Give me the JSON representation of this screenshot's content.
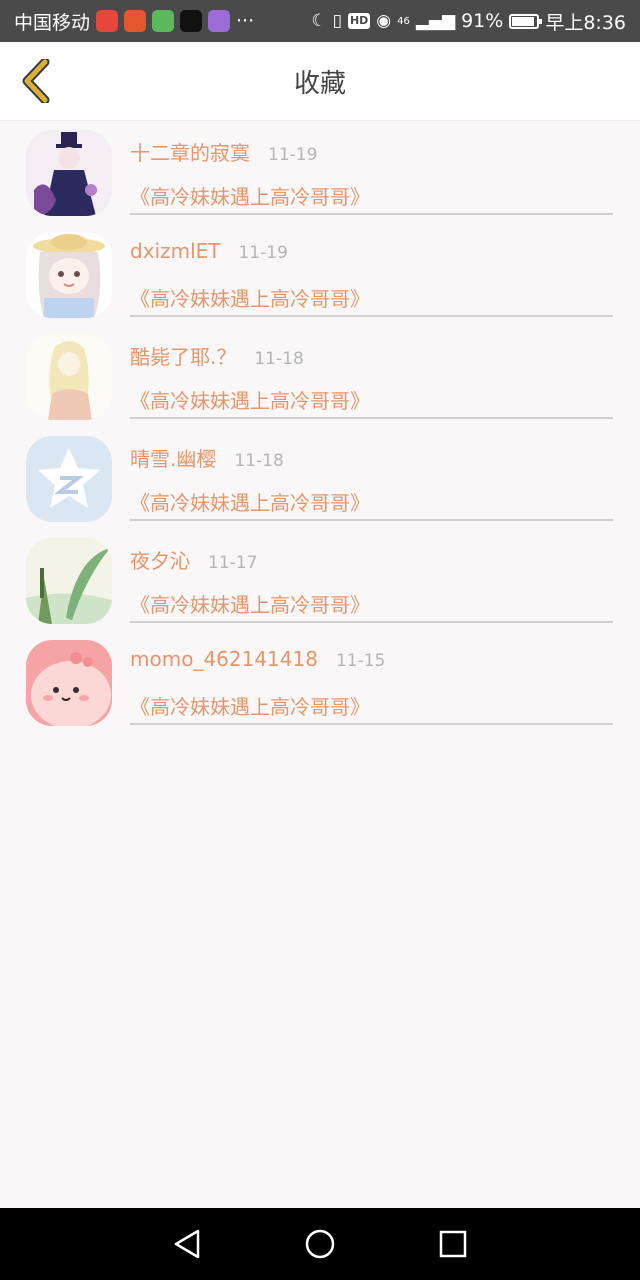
{
  "status_bar": {
    "carrier": "中国移动",
    "more": "···",
    "signal": "46",
    "battery_percent": "91%",
    "time": "早上8:36",
    "hd": "HD"
  },
  "header": {
    "title": "收藏",
    "back_icon": "chevron-left-icon"
  },
  "favorites": [
    {
      "name": "十二章的寂寞",
      "date": "11-19",
      "book": "《高冷妹妹遇上高冷哥哥》"
    },
    {
      "name": "dxizmlET",
      "date": "11-19",
      "book": "《高冷妹妹遇上高冷哥哥》"
    },
    {
      "name": "酷毙了耶.？",
      "date": "11-18",
      "book": "《高冷妹妹遇上高冷哥哥》"
    },
    {
      "name": "晴雪.幽樱",
      "date": "11-18",
      "book": "《高冷妹妹遇上高冷哥哥》"
    },
    {
      "name": "夜夕沁",
      "date": "11-17",
      "book": "《高冷妹妹遇上高冷哥哥》"
    },
    {
      "name": "momo_462141418",
      "date": "11-15",
      "book": "《高冷妹妹遇上高冷哥哥》"
    }
  ],
  "colors": {
    "accent": "#e6966a",
    "back_arrow": "#d9b13a"
  }
}
